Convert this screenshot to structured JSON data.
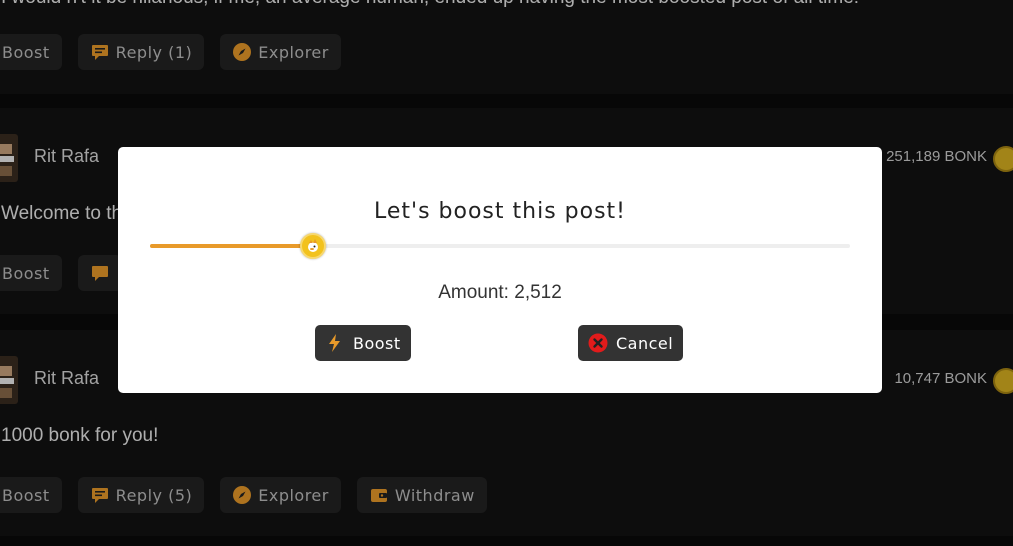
{
  "posts": [
    {
      "text": "I would n't it be hilarious, if me, an average human, ended up having the most boosted post of all time!",
      "actions": {
        "boost": "Boost",
        "reply": "Reply (1)",
        "explorer": "Explorer"
      }
    },
    {
      "user": "Rit Rafa",
      "bonk": "251,189 BONK",
      "text": "Welcome to the",
      "actions": {
        "boost": "Boost"
      }
    },
    {
      "user": "Rit Rafa",
      "bonk": "10,747 BONK",
      "text": "1000 bonk for you!",
      "actions": {
        "boost": "Boost",
        "reply": "Reply (5)",
        "explorer": "Explorer",
        "withdraw": "Withdraw"
      }
    }
  ],
  "modal": {
    "title": "Let's boost this post!",
    "slider_fraction": 0.233,
    "amount_label": "Amount:",
    "amount_value": "2,512",
    "boost_label": "Boost",
    "cancel_label": "Cancel"
  },
  "colors": {
    "accent": "#e89a2a",
    "cancel_red": "#e11b1b",
    "page_bg": "#0a0a0a"
  },
  "icons": {
    "reply": "comment-icon",
    "explorer": "compass-icon",
    "withdraw": "wallet-icon",
    "boost": "lightning-icon",
    "cancel": "close-circle-icon",
    "bonk": "bonk-coin-icon"
  }
}
